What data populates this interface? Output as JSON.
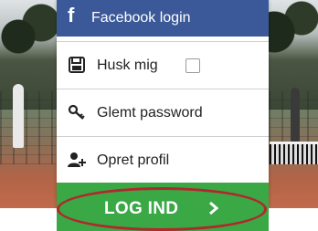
{
  "facebook": {
    "label": "Facebook login",
    "icon": "facebook-icon"
  },
  "remember": {
    "label": "Husk mig",
    "icon": "floppy-disk-icon",
    "checked": false
  },
  "forgot": {
    "label": "Glemt password",
    "icon": "key-icon"
  },
  "create": {
    "label": "Opret profil",
    "icon": "add-user-icon"
  },
  "login": {
    "label": "LOG IND",
    "icon": "chevron-right-icon"
  },
  "colors": {
    "facebook": "#3b5998",
    "login": "#39a845",
    "highlight": "#b3262d"
  }
}
